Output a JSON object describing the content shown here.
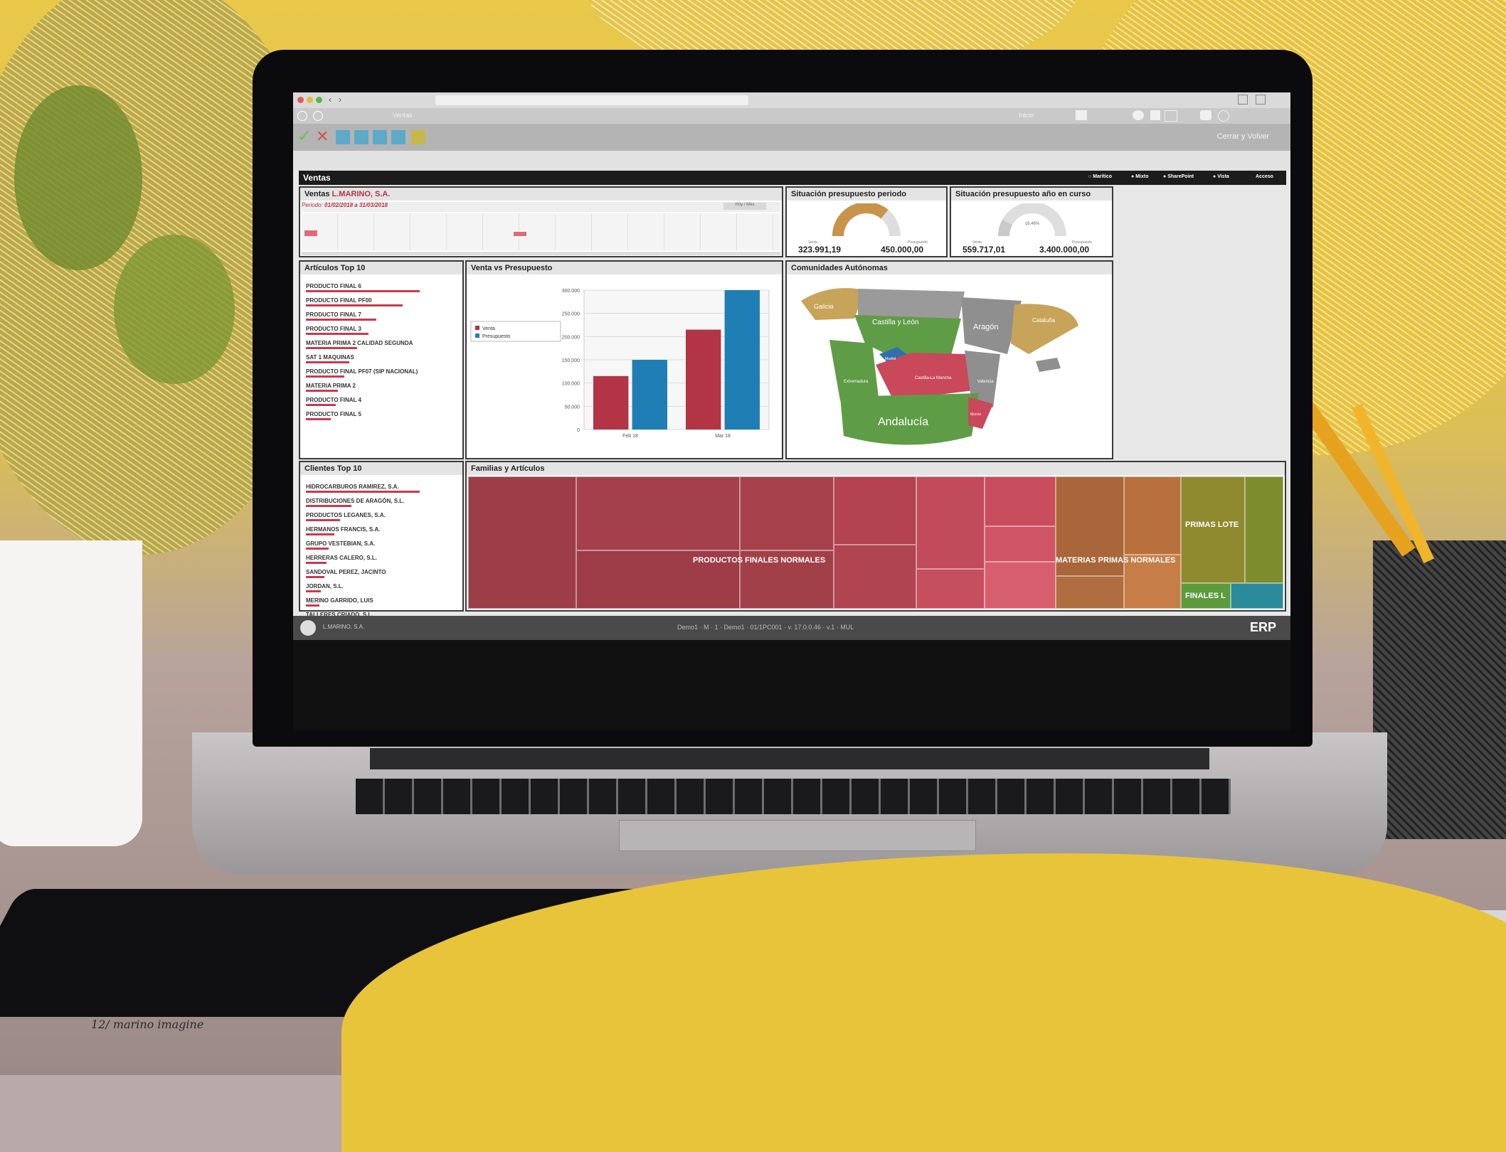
{
  "footer_page": "12/ marino imagine",
  "app": {
    "window_controls": [
      "close",
      "minimize",
      "zoom"
    ],
    "nav": [
      "back",
      "forward"
    ],
    "toolbar_title": "Ventas",
    "toolbar_right": [
      "Inicio"
    ],
    "action_icons": [
      "check-icon",
      "cross-icon",
      "save-icon",
      "copy-icon",
      "print-icon",
      "export-icon"
    ],
    "close_label": "Cerrar y Volver",
    "header_title": "Ventas",
    "view_options": [
      "Marítico",
      "Mixto",
      "SharePoint",
      "Vista"
    ],
    "access_label": "Acceso"
  },
  "sales_panel": {
    "title": "Ventas",
    "company": "L.MARINO, S.A.",
    "period_label": "Periodo",
    "period": "01/02/2018 a 31/03/2018",
    "nav_button": "Hoy / Mes"
  },
  "gauge_period": {
    "title": "Situación presupuesto periodo",
    "percent": "71,81%",
    "value_label": "Venta",
    "budget_label": "Presupuesto",
    "value": "323.991,19",
    "budget": "450.000,00",
    "fill_fraction": 0.72,
    "color": "#c8934a"
  },
  "gauge_year": {
    "title": "Situación presupuesto año en curso",
    "percent": "16,46%",
    "value_label": "Venta",
    "budget_label": "Presupuesto",
    "value": "559.717,01",
    "budget": "3.400.000,00",
    "fill_fraction": 0.16,
    "color": "#c9c9c9"
  },
  "articles": {
    "title": "Artículos Top 10",
    "items": [
      {
        "name": "PRODUCTO FINAL 6",
        "share": 1.0
      },
      {
        "name": "PRODUCTO FINAL PF00",
        "share": 0.85
      },
      {
        "name": "PRODUCTO FINAL 7",
        "share": 0.62
      },
      {
        "name": "PRODUCTO FINAL 3",
        "share": 0.55
      },
      {
        "name": "MATERIA PRIMA 2 CALIDAD SEGUNDA",
        "share": 0.45
      },
      {
        "name": "SAT 1 MAQUINAS",
        "share": 0.38
      },
      {
        "name": "PRODUCTO FINAL PF07 (SIP NACIONAL)",
        "share": 0.34
      },
      {
        "name": "MATERIA PRIMA 2",
        "share": 0.28
      },
      {
        "name": "PRODUCTO FINAL 4",
        "share": 0.26
      },
      {
        "name": "PRODUCTO FINAL 5",
        "share": 0.22
      }
    ]
  },
  "clients": {
    "title": "Clientes Top 10",
    "items": [
      {
        "name": "HIDROCARBUROS RAMIREZ, S.A.",
        "share": 1.0
      },
      {
        "name": "DISTRIBUCIONES DE ARAGÓN, S.L.",
        "share": 0.4
      },
      {
        "name": "PRODUCTOS LEGANES, S.A.",
        "share": 0.3
      },
      {
        "name": "HERMANOS FRANCIS, S.A.",
        "share": 0.25
      },
      {
        "name": "GRUPO VESTEBIAN, S.A.",
        "share": 0.2
      },
      {
        "name": "HERRERAS CALERO, S.L.",
        "share": 0.18
      },
      {
        "name": "SANDOVAL PEREZ, JACINTO",
        "share": 0.16
      },
      {
        "name": "JORDAN, S.L.",
        "share": 0.13
      },
      {
        "name": "MERINO GARRIDO, LUIS",
        "share": 0.12
      },
      {
        "name": "TALLERES CRIADO, S.L.",
        "share": 0.1
      }
    ]
  },
  "chart_panel": {
    "title": "Venta vs Presupuesto"
  },
  "chart_data": {
    "type": "bar",
    "categories": [
      "Feb 18",
      "Mar 18"
    ],
    "series": [
      {
        "name": "Venta",
        "values": [
          115000,
          215000
        ],
        "color": "#b23445"
      },
      {
        "name": "Presupuesto",
        "values": [
          150000,
          300000
        ],
        "color": "#1f7fb4"
      }
    ],
    "ylim": [
      0,
      300000
    ],
    "yticks": [
      "0",
      "50.000",
      "100.000",
      "150.000",
      "200.000",
      "250.000",
      "300.000"
    ],
    "legend_position": "left"
  },
  "map_panel": {
    "title": "Comunidades Autónomas",
    "labels": [
      "Galicia",
      "Castilla y León",
      "Aragón",
      "Cataluña",
      "Madrid",
      "Castilla-La Mancha",
      "Extremadura",
      "Valencia",
      "Andalucía",
      "Murcia"
    ]
  },
  "treemap_panel": {
    "title": "Familias y Artículos",
    "group_labels": [
      "PRODUCTOS FINALES NORMALES",
      "MATERIAS PRIMAS NORMALES",
      "PRIMAS LOTE",
      "FINALES L"
    ]
  },
  "status_bar": {
    "company": "L.MARINO, S.A.",
    "center": "Demo1 · M · 1 · Demo1 · 01/1PC001 · v. 17.0.0.46 · v.1 · MUL",
    "brand": "ERP"
  }
}
